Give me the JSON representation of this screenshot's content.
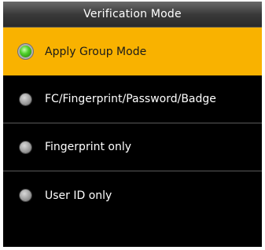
{
  "screen": {
    "title": "Verification Mode"
  },
  "options": [
    {
      "label": "Apply Group Mode",
      "selected": true,
      "radio_icon": "radio-selected-icon"
    },
    {
      "label": "FC/Fingerprint/Password/Badge",
      "selected": false,
      "radio_icon": "radio-unselected-icon"
    },
    {
      "label": "Fingerprint only",
      "selected": false,
      "radio_icon": "radio-unselected-icon"
    },
    {
      "label": "User ID only",
      "selected": false,
      "radio_icon": "radio-unselected-icon"
    }
  ],
  "colors": {
    "selected_background": "#f9b200",
    "background": "#000000",
    "radio_on": "#4fd02a",
    "radio_off": "#a8a8a8"
  }
}
